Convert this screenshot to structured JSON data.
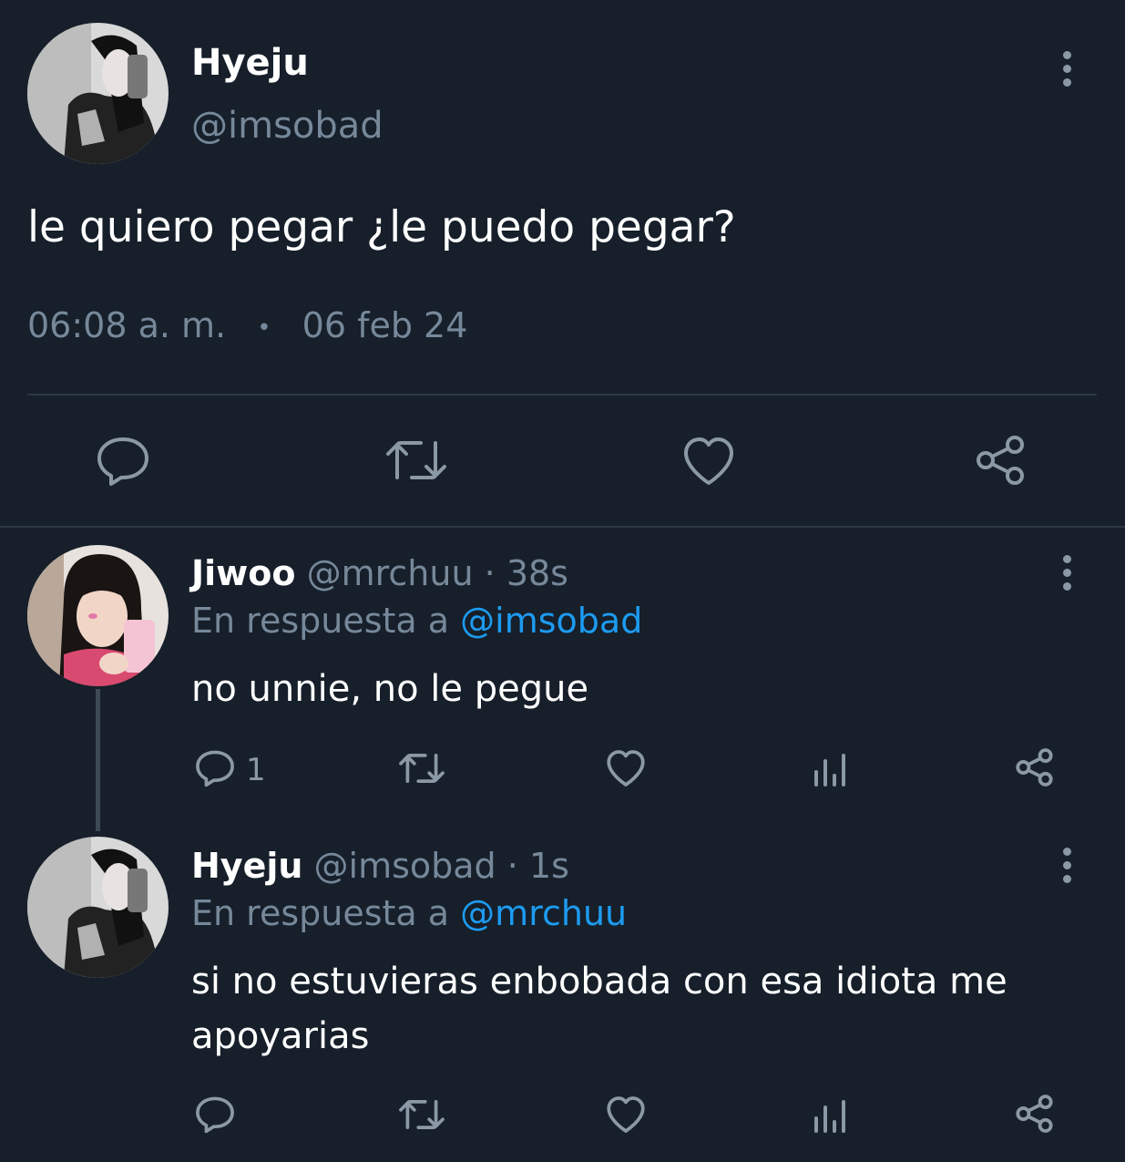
{
  "main_tweet": {
    "name": "Hyeju",
    "handle": "@imsobad",
    "text": "le quiero pegar ¿le puedo pegar?",
    "time": "06:08 a. m.",
    "separator": "•",
    "date": "06 feb 24",
    "icons": [
      "reply-icon",
      "retweet-icon",
      "like-icon",
      "share-icon"
    ]
  },
  "replies": [
    {
      "name": "Jiwoo",
      "handle": "@mrchuu",
      "dot": "·",
      "time": "38s",
      "reply_prefix": "En respuesta a",
      "reply_to": "@imsobad",
      "text": "no unnie, no le pegue",
      "reply_count": "1"
    },
    {
      "name": "Hyeju",
      "handle": "@imsobad",
      "dot": "·",
      "time": "1s",
      "reply_prefix": "En respuesta a",
      "reply_to": "@mrchuu",
      "text_line1": "si no estuvieras enbobada con esa idiota me",
      "text_line2": "apoyarias",
      "reply_count": ""
    }
  ],
  "colors": {
    "background": "#161f2a",
    "muted": "#76889a",
    "link": "#1d9bf0",
    "icon": "#8b98a5"
  }
}
